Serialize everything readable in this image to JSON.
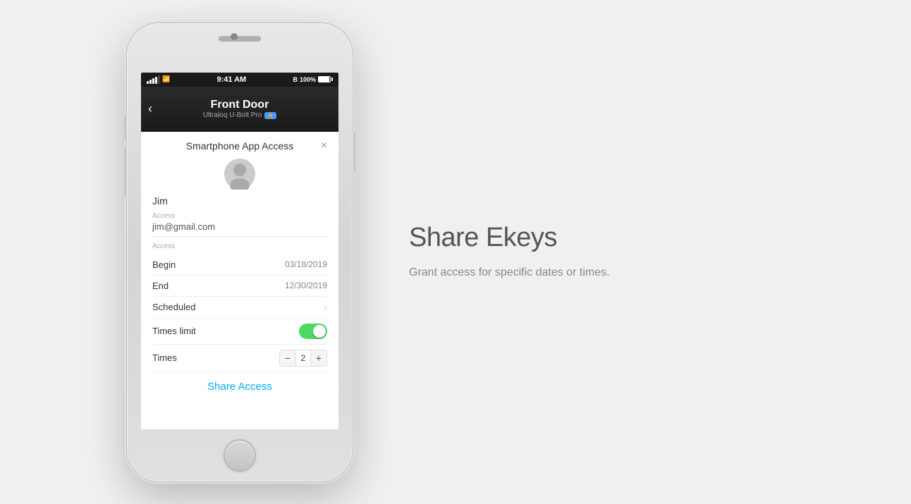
{
  "page": {
    "background": "#f0f0f0"
  },
  "phone": {
    "status_bar": {
      "time": "9:41 AM",
      "battery_text": "100%",
      "bluetooth_icon": "bluetooth"
    },
    "app_header": {
      "back_label": "‹",
      "title": "Front Door",
      "subtitle": "Ultraloq U-Bolt Pro",
      "lock_badge": "🔒"
    },
    "modal": {
      "title": "Smartphone App Access",
      "close_icon": "×",
      "user_name": "Jim",
      "access_label1": "Access",
      "access_email": "jim@gmail.com",
      "access_label2": "Access",
      "begin_label": "Begin",
      "begin_value": "03/18/2019",
      "end_label": "End",
      "end_value": "12/30/2019",
      "scheduled_label": "Scheduled",
      "times_limit_label": "Times limit",
      "times_label": "Times",
      "times_value": "2",
      "share_button": "Share Access"
    }
  },
  "right_panel": {
    "title": "Share Ekeys",
    "description": "Grant access for specific dates or times."
  }
}
